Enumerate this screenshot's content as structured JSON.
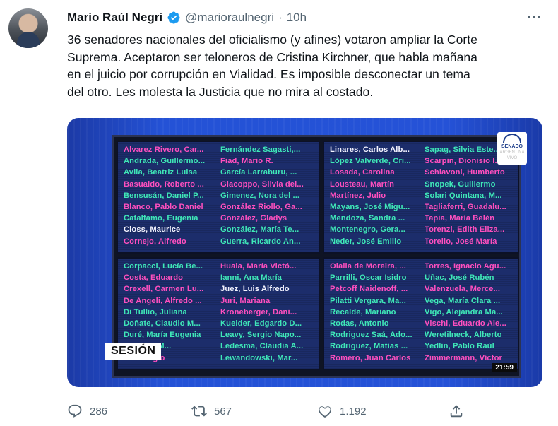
{
  "author": {
    "name": "Mario Raúl Negri",
    "handle": "@marioraulnegri",
    "separator": "·",
    "time": "10h"
  },
  "tweet": {
    "lines": [
      "36 senadores nacionales del oficialismo (y afines) votaron ampliar la Corte",
      "Suprema. Aceptaron ser teloneros de Cristina Kirchner, que habla mañana",
      "en el juicio por corrupción en Vialidad. Es imposible desconectar un tema",
      "del otro. Les molesta la Justicia que no mira al costado."
    ]
  },
  "media": {
    "session_label": "SESIÓN",
    "clock": "21:59",
    "logo_text": "SENADO",
    "logo_sub": "ARGENTINA",
    "logo_live": "VIVO",
    "panels": [
      {
        "col1": [
          {
            "t": "Alvarez Rivero, Car...",
            "c": "pink"
          },
          {
            "t": "Andrada, Guillermo...",
            "c": "green"
          },
          {
            "t": "Avila, Beatriz Luisa",
            "c": "green"
          },
          {
            "t": "Basualdo, Roberto ...",
            "c": "pink"
          },
          {
            "t": "Bensusán, Daniel P...",
            "c": "green"
          },
          {
            "t": "Blanco, Pablo Daniel",
            "c": "pink"
          },
          {
            "t": "Catalfamo, Eugenia",
            "c": "green"
          },
          {
            "t": "Closs, Maurice",
            "c": "white"
          },
          {
            "t": "Cornejo, Alfredo",
            "c": "pink"
          }
        ],
        "col2": [
          {
            "t": "Fernández Sagasti,...",
            "c": "green"
          },
          {
            "t": "Fiad, Mario R.",
            "c": "pink"
          },
          {
            "t": "García Larraburu, ...",
            "c": "green"
          },
          {
            "t": "Giacoppo, Silvia del...",
            "c": "pink"
          },
          {
            "t": "Gimenez, Nora del ...",
            "c": "green"
          },
          {
            "t": "González Riollo, Ga...",
            "c": "pink"
          },
          {
            "t": "González, Gladys",
            "c": "pink"
          },
          {
            "t": "González, María Te...",
            "c": "green"
          },
          {
            "t": "Guerra, Ricardo An...",
            "c": "green"
          }
        ]
      },
      {
        "col1": [
          {
            "t": "Linares, Carlos Alb...",
            "c": "white"
          },
          {
            "t": "López Valverde, Cri...",
            "c": "green"
          },
          {
            "t": "Losada, Carolina",
            "c": "pink"
          },
          {
            "t": "Lousteau, Martín",
            "c": "pink"
          },
          {
            "t": "Martínez, Julio",
            "c": "pink"
          },
          {
            "t": "Mayans, José Migu...",
            "c": "green"
          },
          {
            "t": "Mendoza, Sandra ...",
            "c": "green"
          },
          {
            "t": "Montenegro, Gera...",
            "c": "green"
          },
          {
            "t": "Neder, José Emilio",
            "c": "green"
          }
        ],
        "col2": [
          {
            "t": "Sapag, Silvia Este...",
            "c": "green"
          },
          {
            "t": "Scarpin, Dionisio I...",
            "c": "pink"
          },
          {
            "t": "Schiavoni, Humberto",
            "c": "pink"
          },
          {
            "t": "Snopek, Guillermo",
            "c": "green"
          },
          {
            "t": "Solari Quintana, M...",
            "c": "green"
          },
          {
            "t": "Tagliaferri, Guadalu...",
            "c": "pink"
          },
          {
            "t": "Tapia, María Belén",
            "c": "pink"
          },
          {
            "t": "Torenzi, Edith Eliza...",
            "c": "pink"
          },
          {
            "t": "Torello, José María",
            "c": "pink"
          }
        ]
      },
      {
        "col1": [
          {
            "t": "Corpacci, Lucía Be...",
            "c": "green"
          },
          {
            "t": "Costa, Eduardo",
            "c": "pink"
          },
          {
            "t": "Crexell, Carmen Lu...",
            "c": "pink"
          },
          {
            "t": "De Angeli, Alfredo ...",
            "c": "pink"
          },
          {
            "t": "Di Tullio, Juliana",
            "c": "green"
          },
          {
            "t": "Doñate, Claudio M...",
            "c": "green"
          },
          {
            "t": "Duré, María Eugenia",
            "c": "green"
          },
          {
            "t": "...Carlos M...",
            "c": "green"
          },
          {
            "t": "...io Sergio",
            "c": "pink"
          }
        ],
        "col2": [
          {
            "t": "Huala, María Victó...",
            "c": "pink"
          },
          {
            "t": "Ianni, Ana María",
            "c": "green"
          },
          {
            "t": "Juez, Luis Alfredo",
            "c": "white"
          },
          {
            "t": "Juri, Mariana",
            "c": "pink"
          },
          {
            "t": "Kroneberger, Dani...",
            "c": "pink"
          },
          {
            "t": "Kueider, Edgardo D...",
            "c": "green"
          },
          {
            "t": "Leavy, Sergio Napo...",
            "c": "green"
          },
          {
            "t": "Ledesma, Claudia A...",
            "c": "green"
          },
          {
            "t": "Lewandowski, Mar...",
            "c": "green"
          }
        ]
      },
      {
        "col1": [
          {
            "t": "Olalla de Moreira, ...",
            "c": "pink"
          },
          {
            "t": "Parrilli, Oscar Isidro",
            "c": "green"
          },
          {
            "t": "Petcoff Naidenoff, ...",
            "c": "pink"
          },
          {
            "t": "Pilatti Vergara, Ma...",
            "c": "green"
          },
          {
            "t": "Recalde, Mariano",
            "c": "green"
          },
          {
            "t": "Rodas, Antonio",
            "c": "green"
          },
          {
            "t": "Rodriguez Saá, Ado...",
            "c": "green"
          },
          {
            "t": "Rodriguez, Matías ...",
            "c": "green"
          },
          {
            "t": "Romero, Juan Carlos",
            "c": "pink"
          }
        ],
        "col2": [
          {
            "t": "Torres, Ignacio Agu...",
            "c": "pink"
          },
          {
            "t": "Uñac, José Rubén",
            "c": "green"
          },
          {
            "t": "Valenzuela, Merce...",
            "c": "pink"
          },
          {
            "t": "Vega, María Clara ...",
            "c": "green"
          },
          {
            "t": "Vigo, Alejandra Ma...",
            "c": "green"
          },
          {
            "t": "Vischi, Eduardo Ale...",
            "c": "pink"
          },
          {
            "t": "Weretilneck, Alberto",
            "c": "green"
          },
          {
            "t": "Yedlin, Pablo Raúl",
            "c": "green"
          },
          {
            "t": "Zimmermann, Víctor",
            "c": "pink"
          }
        ]
      }
    ]
  },
  "actions": {
    "replies": "286",
    "retweets": "567",
    "likes": "1.192"
  },
  "colors": {
    "verified": "#1d9bf0",
    "muted": "#536471",
    "vote_yes": "#3fe8b8",
    "vote_no": "#ff4fbf"
  },
  "icons": {
    "verified": "verified-badge-icon",
    "more": "more-options-icon",
    "reply": "reply-icon",
    "retweet": "retweet-icon",
    "like": "heart-icon",
    "share": "share-icon"
  }
}
